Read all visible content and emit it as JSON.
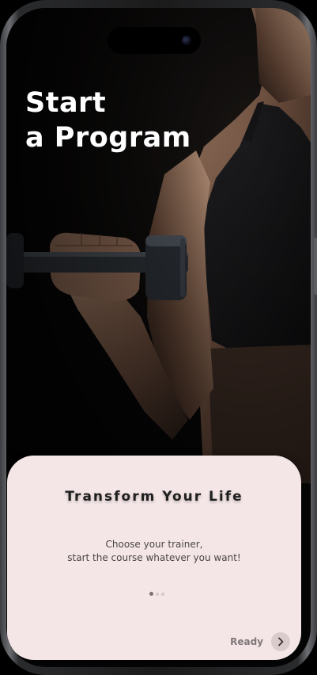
{
  "hero": {
    "title_line1": "Start",
    "title_line2": "a Program"
  },
  "card": {
    "title": "Transform Your Life",
    "subtitle_line1": "Choose your trainer,",
    "subtitle_line2": "start the course whatever you want!",
    "pagination": {
      "total": 3,
      "active_index": 0
    },
    "ready_label": "Ready",
    "next_icon": "chevron-right-icon"
  },
  "colors": {
    "card_background": "#f4e6e7",
    "title_text": "#1f1f1f",
    "hero_text": "#ffffff",
    "button_background": "#d9cacc"
  }
}
